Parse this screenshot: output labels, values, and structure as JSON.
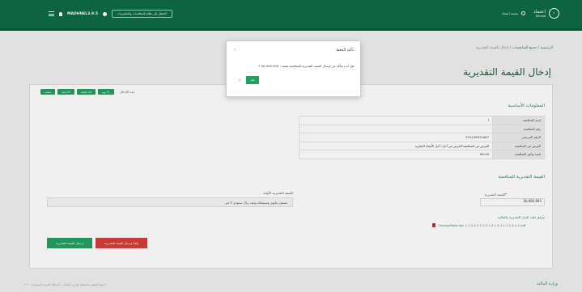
{
  "header": {
    "user_name": "MADHNEL3.9.5",
    "switch_label": "الانتقال إلى نظام المنافسات والمشتريات",
    "platform_label": "منصة اعتماد",
    "logo_text": "اعتماد",
    "logo_sub": "Etimad"
  },
  "breadcrumb": {
    "home": "الرئيسية",
    "sep1": " / ",
    "all": "جميع المنافسات",
    "sep2": " / ",
    "current": "إدخال القيمة التقديرية"
  },
  "page_title": "إدخال القيمة التقديرية",
  "status": {
    "duration_label": "مدة الإدخال",
    "pills": [
      "٧١ يوم",
      "٤٥ دقيقة",
      "٥٩ ثانية",
      "مضت"
    ]
  },
  "basic_info": {
    "title": "المعلومات الأساسية",
    "rows": [
      {
        "label": "إسم المنافسة",
        "value": "ا"
      },
      {
        "label": "رقم المنافسة",
        "value": ""
      },
      {
        "label": "الرقم المرجعي",
        "value": "231139574467"
      },
      {
        "label": "الغرض من المنافسة",
        "value": "الغرض من المنافسة:الغرض من أجل: أجل الأشياء التجارية"
      },
      {
        "label": "قيمة وثائق المنافسة",
        "value": "65.00"
      }
    ]
  },
  "estimate": {
    "title": "القيمة التقديرية للمنافسة",
    "label": "القيمة التقديرية",
    "required_mark": "*",
    "value": "30,000,965",
    "attach_label": "مرفق ملف البيان التقديرية والمالية",
    "file_name": "ConsignNote.doc 1.1.2.2.3.1.2.5.1.3.1.5.1.1.1.2.4.1.1.pdf"
  },
  "previous": {
    "label": "القيمة التقديرية الأولية",
    "value": "تسعون مليون وسبعمائة ونيف ريال سعودي لا غير"
  },
  "buttons": {
    "send": "إرسال القيمة التقديرية",
    "cancel": "إلغاء إرسال القيمة التقديرية"
  },
  "modal": {
    "title": "تأكيد الحفظ",
    "close": "×",
    "body": "هل أنت متأكد من إرسال القيمة التقديرية للمنافسة بقيمة : 90,000,900 ؟",
    "yes": "نعم",
    "no": "لا"
  },
  "footer": {
    "text": "جميع الحقوق محفوظة لوزارة المالية - المملكة العربية السعودية ٢٠٢٠",
    "logo": "وزارة المالية"
  }
}
